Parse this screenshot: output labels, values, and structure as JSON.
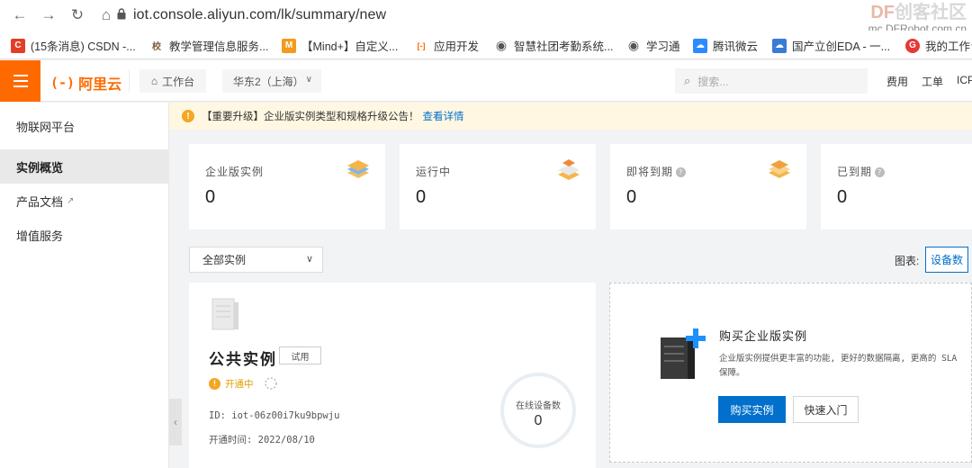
{
  "browser": {
    "url": "iot.console.aliyun.com/lk/summary/new",
    "watermark_title_prefix": "DF",
    "watermark_title_rest": "创客社区",
    "watermark_sub": "mc.DFRobot.com.cn",
    "bookmarks": [
      {
        "label": "(15条消息) CSDN -...",
        "icon": "csdn-icon",
        "color": "#e33e27",
        "glyph": "C"
      },
      {
        "label": "教学管理信息服务...",
        "icon": "school-icon",
        "color": "#7a5c3a",
        "glyph": "校"
      },
      {
        "label": "【Mind+】自定义...",
        "icon": "mindplus-icon",
        "color": "#f39a1e",
        "glyph": "M"
      },
      {
        "label": "应用开发",
        "icon": "aliyun-icon",
        "color": "#ff6a00",
        "glyph": "[-]"
      },
      {
        "label": "智慧社团考勤系统...",
        "icon": "globe-icon",
        "color": "#555",
        "glyph": "◉"
      },
      {
        "label": "学习通",
        "icon": "globe-icon",
        "color": "#555",
        "glyph": "◉"
      },
      {
        "label": "腾讯微云",
        "icon": "weiyun-icon",
        "color": "#2a8cff",
        "glyph": "☁"
      },
      {
        "label": "国产立创EDA - 一...",
        "icon": "eda-icon",
        "color": "#3a7bd5",
        "glyph": "☁"
      },
      {
        "label": "我的工作台",
        "icon": "workbench-icon",
        "color": "#e53935",
        "glyph": "G"
      }
    ]
  },
  "topbar": {
    "logo_mark": "(-)",
    "logo_text": "阿里云",
    "workbench": "工作台",
    "region": "华东2（上海）",
    "search_placeholder": "搜索...",
    "links": [
      "费用",
      "工单",
      "ICP"
    ]
  },
  "sidebar": {
    "title": "物联网平台",
    "items": [
      {
        "label": "实例概览",
        "active": true
      },
      {
        "label": "产品文档",
        "external": true
      },
      {
        "label": "增值服务"
      }
    ],
    "external_glyph": "↗",
    "collapse_glyph": "‹"
  },
  "notice": {
    "icon": "!",
    "text": "【重要升级】企业版实例类型和规格升级公告！",
    "link": "查看详情"
  },
  "stats": [
    {
      "label": "企业版实例",
      "value": "0",
      "help": false,
      "icon": "blue-stack-icon"
    },
    {
      "label": "运行中",
      "value": "0",
      "help": false,
      "icon": "green-stack-icon"
    },
    {
      "label": "即将到期",
      "value": "0",
      "help": true,
      "icon": "orange-stack-icon"
    },
    {
      "label": "已到期",
      "value": "0",
      "help": true,
      "icon": "none"
    }
  ],
  "help_glyph": "?",
  "filter": {
    "label": "全部实例",
    "chevron": "∨"
  },
  "chart": {
    "label": "图表:",
    "button": "设备数"
  },
  "instance": {
    "title": "公共实例",
    "badge": "试用",
    "status_icon": "!",
    "status": "开通中",
    "id": "ID: iot-06z00i7ku9bpwju",
    "opened": "开通时间: 2022/08/10",
    "online_label": "在线设备数",
    "online_value": "0"
  },
  "buy": {
    "title": "购买企业版实例",
    "desc": "企业版实例提供更丰富的功能, 更好的数据隔离, 更高的 SLA 保障。",
    "primary": "购买实例",
    "secondary": "快速入门"
  },
  "colors": {
    "accent": "#ff6a00",
    "primary": "#0070cc",
    "notice_bg": "#fff7e1",
    "warning": "#f5a623"
  }
}
